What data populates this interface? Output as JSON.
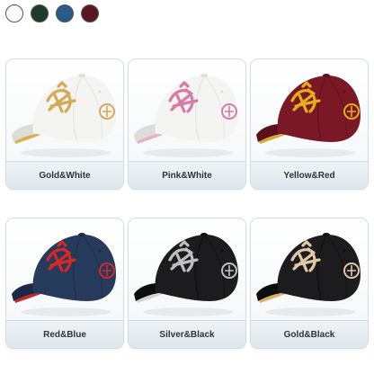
{
  "swatches": [
    {
      "name": "white",
      "color": "#ffffff"
    },
    {
      "name": "green",
      "color": "#1e3b2c"
    },
    {
      "name": "blue",
      "color": "#2a5a86"
    },
    {
      "name": "red",
      "color": "#5c1522"
    }
  ],
  "cards": [
    {
      "label": "Gold&White",
      "cap": "#f4f4f2",
      "shade": "#dcdcd8",
      "emb": "#d3ab58",
      "lining": "#d9b24e"
    },
    {
      "label": "Pink&White",
      "cap": "#f4f4f2",
      "shade": "#dcdcd8",
      "emb": "#d87aa6",
      "lining": "#e2b3c7"
    },
    {
      "label": "Yellow&Red",
      "cap": "#7a1826",
      "shade": "#5a0f1b",
      "emb": "#e6ad1a",
      "lining": "#d6a83c"
    },
    {
      "label": "Red&Blue",
      "cap": "#263a5c",
      "shade": "#1a2a45",
      "emb": "#d52828",
      "lining": "#c22a2a"
    },
    {
      "label": "Silver&Black",
      "cap": "#1c1c1e",
      "shade": "#0d0d0e",
      "emb": "#bfbfbf",
      "lining": "#d4d4d4"
    },
    {
      "label": "Gold&Black",
      "cap": "#1c1c1e",
      "shade": "#0d0d0e",
      "emb": "#e0c7a8",
      "lining": "#d8b064"
    }
  ]
}
